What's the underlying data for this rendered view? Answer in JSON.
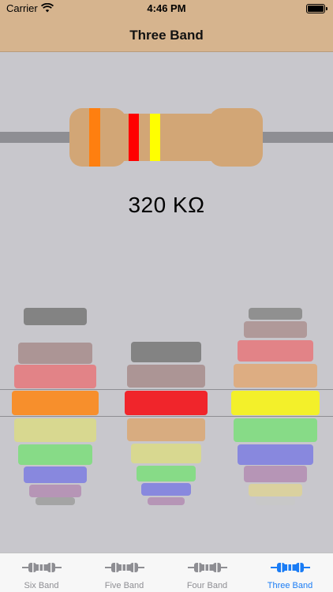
{
  "status_bar": {
    "carrier": "Carrier",
    "time": "4:46 PM"
  },
  "nav": {
    "title": "Three Band"
  },
  "resistor": {
    "band_colors": [
      "#ff7f0f",
      "#ff0000",
      "#ffff00"
    ],
    "body_color": "#d2a676"
  },
  "value": "320 KΩ",
  "picker": {
    "wheels": [
      {
        "name": "band-1",
        "selected": "orange",
        "colors": [
          "#7b7b7b",
          "#a88f8f",
          "#e47b80",
          "#f78f2c",
          "#d9d98a",
          "#80dd80",
          "#8181e0",
          "#b48fb4",
          "#a0a0a0"
        ]
      },
      {
        "name": "band-2",
        "selected": "red",
        "colors": [
          "#7b7b7b",
          "#a88f8f",
          "#f0252b",
          "#d9a878",
          "#d9d98a",
          "#80dd80",
          "#8181e0",
          "#b48fb4"
        ]
      },
      {
        "name": "multiplier",
        "selected": "yellow",
        "colors": [
          "#8a8a8a",
          "#ad9393",
          "#e47b80",
          "#dfaa7a",
          "#f3f02a",
          "#80dd80",
          "#8181e0",
          "#b48fb4",
          "#dcd29a",
          "#c8c8c8"
        ]
      }
    ]
  },
  "tab_bar": {
    "tabs": [
      {
        "label": "Six Band",
        "icon": "resistor-icon",
        "active": false
      },
      {
        "label": "Five Band",
        "icon": "resistor-icon",
        "active": false
      },
      {
        "label": "Four Band",
        "icon": "resistor-icon",
        "active": false
      },
      {
        "label": "Three Band",
        "icon": "resistor-icon",
        "active": true
      }
    ],
    "active_color": "#1a7cf5",
    "inactive_color": "#8e8e93"
  }
}
